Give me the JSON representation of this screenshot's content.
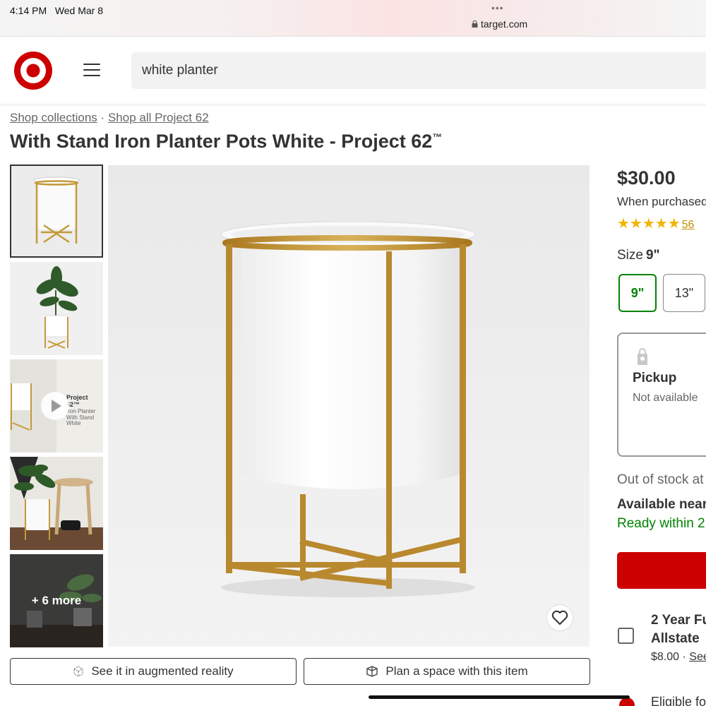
{
  "status_bar": {
    "time": "4:14 PM",
    "date": "Wed Mar 8",
    "dots": "•••",
    "url": "target.com"
  },
  "header": {
    "search_value": "white planter",
    "brand_color": "#cc0000"
  },
  "breadcrumb": {
    "items": [
      "Shop collections",
      "Shop all Project 62"
    ],
    "separator": "·"
  },
  "product": {
    "title": "With Stand Iron Planter Pots White - Project 62",
    "trademark": "™",
    "thumbnails": [
      {
        "kind": "planter-front",
        "selected": true
      },
      {
        "kind": "planter-with-plant"
      },
      {
        "kind": "video",
        "brand_text": "Project 62™",
        "sub_text": "Iron Planter With Stand White"
      },
      {
        "kind": "lifestyle"
      },
      {
        "kind": "more",
        "label": "+ 6 more"
      }
    ],
    "ar_button": "See it in augmented reality",
    "plan_button": "Plan a space with this item"
  },
  "purchase": {
    "price": "$30.00",
    "when_purchased": "When purchased",
    "stars": "★★★★★",
    "rating_count": "56",
    "size_label": "Size",
    "size_value": "9\"",
    "sizes": [
      "9\"",
      "13\""
    ],
    "pickup_title": "Pickup",
    "pickup_status": "Not available",
    "out_of_stock": "Out of stock at",
    "available_near": "Available near",
    "ready_within": "Ready within 2",
    "protection_title_1": "2 Year Fu",
    "protection_title_2": "Allstate",
    "protection_price": "$8.00",
    "protection_link": "See",
    "eligible": "Eligible fo"
  },
  "colors": {
    "target_red": "#cc0000",
    "selected_green": "#008300",
    "star_gold": "#f0b400"
  }
}
